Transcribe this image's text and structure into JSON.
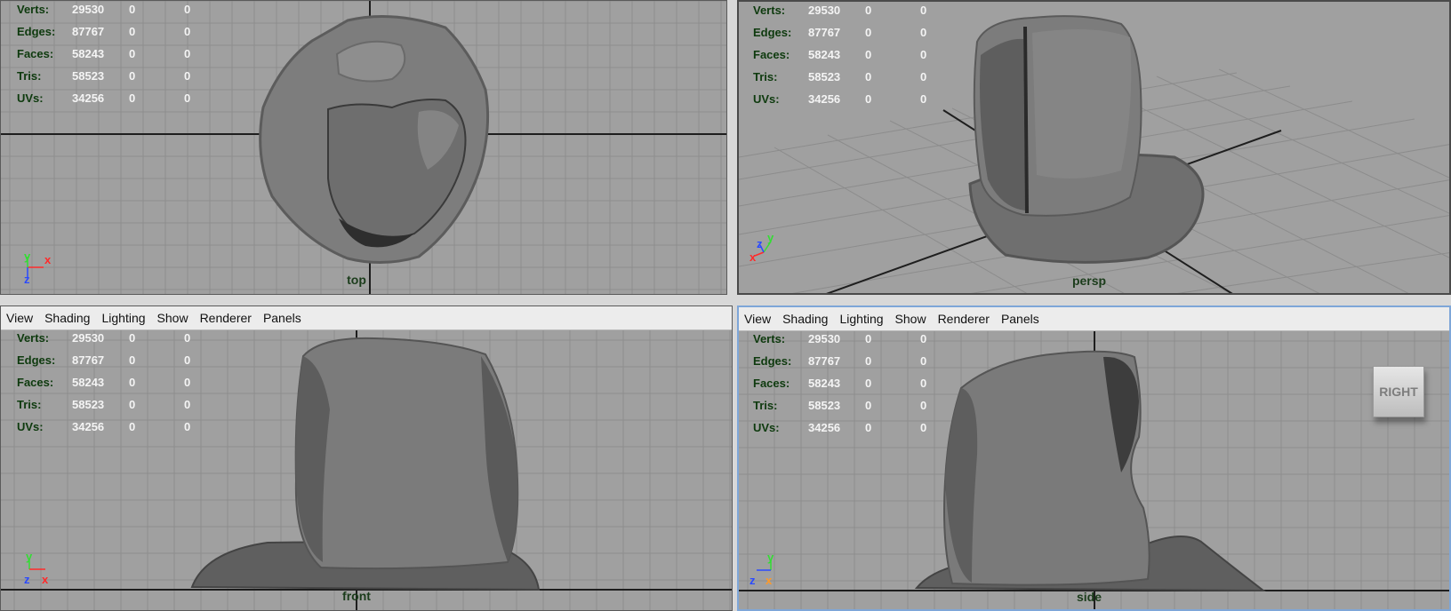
{
  "menu": [
    "View",
    "Shading",
    "Lighting",
    "Show",
    "Renderer",
    "Panels"
  ],
  "hud": {
    "labels": [
      "Verts:",
      "Edges:",
      "Faces:",
      "Tris:",
      "UVs:"
    ],
    "values": [
      [
        "29530",
        "0",
        "0"
      ],
      [
        "87767",
        "0",
        "0"
      ],
      [
        "58243",
        "0",
        "0"
      ],
      [
        "58523",
        "0",
        "0"
      ],
      [
        "34256",
        "0",
        "0"
      ]
    ]
  },
  "viewports": {
    "top": {
      "camera": "top"
    },
    "persp": {
      "camera": "persp"
    },
    "front": {
      "camera": "front"
    },
    "side": {
      "camera": "side",
      "view_cube": "RIGHT"
    }
  },
  "axes": {
    "x": "x",
    "y": "y",
    "z": "z"
  },
  "colors": {
    "x_axis": "#ff2a2a",
    "y_axis": "#33dd33",
    "z_axis": "#2a4aff",
    "viewport_bg": "#a0a0a0",
    "grid": "#8e8e8e",
    "active_border": "#7ea6d8"
  }
}
